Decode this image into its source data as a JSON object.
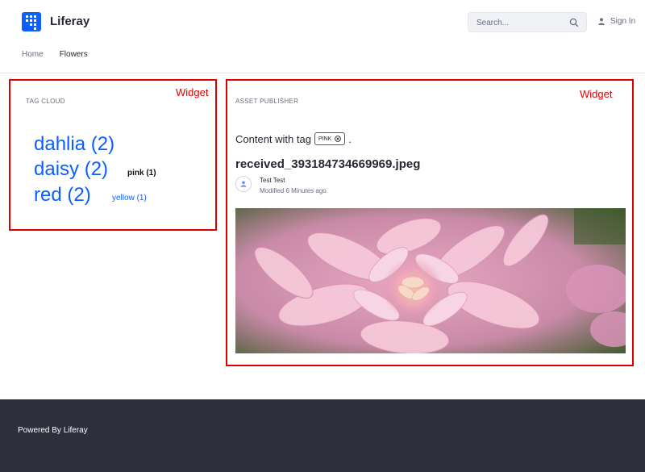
{
  "header": {
    "site_title": "Liferay",
    "search_placeholder": "Search...",
    "sign_in": "Sign In"
  },
  "nav": {
    "items": [
      {
        "label": "Home",
        "active": false
      },
      {
        "label": "Flowers",
        "active": true
      }
    ]
  },
  "widget_left": {
    "annotation": "Widget",
    "title": "TAG CLOUD",
    "tags": [
      {
        "label": "dahlia (2)"
      },
      {
        "label": "daisy (2)"
      },
      {
        "label": "pink (1)"
      },
      {
        "label": "red (2)"
      },
      {
        "label": "yellow (1)"
      }
    ]
  },
  "widget_right": {
    "annotation": "Widget",
    "title": "ASSET PUBLISHER",
    "content_with_tag": "Content with tag",
    "filter_tag": "PINK",
    "period": ".",
    "asset": {
      "title": "received_393184734669969.jpeg",
      "author": "Test Test",
      "modified": "Modified 6 Minutes ago."
    }
  },
  "footer": {
    "text": "Powered By Liferay"
  },
  "colors": {
    "brand": "#0b5fff",
    "annotation": "#e00000",
    "footer_bg": "#2d2f3d"
  },
  "icons": {
    "logo": "liferay-logo-icon",
    "search": "search-icon",
    "user": "user-icon",
    "remove": "remove-tag-icon"
  }
}
